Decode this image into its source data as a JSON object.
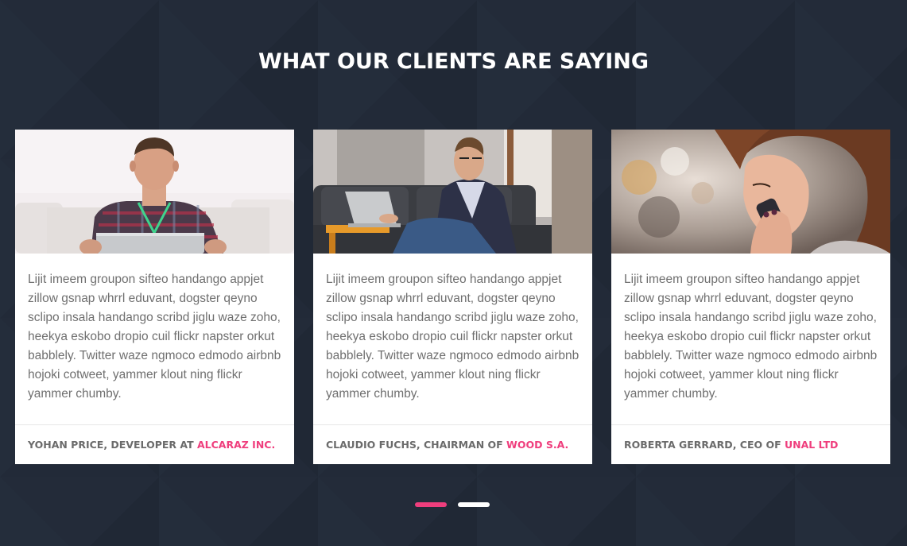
{
  "section": {
    "title": "WHAT OUR CLIENTS ARE SAYING"
  },
  "testimonials": [
    {
      "photo": "man-plaid-shirt-laptop-photo",
      "quote": "Lijit imeem groupon sifteo handango appjet zillow gsnap whrrl eduvant, dogster qeyno sclipo insala handango scribd jiglu waze zoho, heekya eskobo dropio cuil flickr napster orkut babblely. Twitter waze ngmoco edmodo airbnb hojoki cotweet, yammer klout ning flickr yammer chumby.",
      "author": "YOHAN PRICE, DEVELOPER AT",
      "company": "ALCARAZ INC."
    },
    {
      "photo": "man-on-sofa-laptop-photo",
      "quote": "Lijit imeem groupon sifteo handango appjet zillow gsnap whrrl eduvant, dogster qeyno sclipo insala handango scribd jiglu waze zoho, heekya eskobo dropio cuil flickr napster orkut babblely. Twitter waze ngmoco edmodo airbnb hojoki cotweet, yammer klout ning flickr yammer chumby.",
      "author": "CLAUDIO FUCHS, CHAIRMAN OF",
      "company": "WOOD S.A."
    },
    {
      "photo": "woman-on-phone-photo",
      "quote": "Lijit imeem groupon sifteo handango appjet zillow gsnap whrrl eduvant, dogster qeyno sclipo insala handango scribd jiglu waze zoho, heekya eskobo dropio cuil flickr napster orkut babblely. Twitter waze ngmoco edmodo airbnb hojoki cotweet, yammer klout ning flickr yammer chumby.",
      "author": "ROBERTA GERRARD, CEO OF",
      "company": "UNAL LTD"
    }
  ],
  "pager": {
    "active_index": 0,
    "count": 2
  },
  "colors": {
    "background": "#222a38",
    "accent": "#ef3e7d",
    "pager_active": "#ef3e7d",
    "pager_inactive": "#ffffff"
  }
}
